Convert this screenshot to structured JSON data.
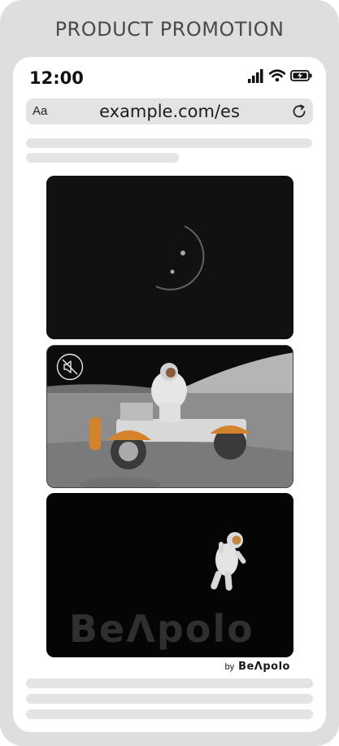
{
  "frame": {
    "title": "PRODUCT PROMOTION"
  },
  "status_bar": {
    "time": "12:00",
    "icons": [
      "cellular-signal-icon",
      "wifi-icon",
      "battery-charging-icon"
    ]
  },
  "browser": {
    "text_size_label": "Aa",
    "url": "example.com/es",
    "reload_icon": "reload-icon"
  },
  "ad": {
    "panels": [
      "moon-panel",
      "lunar-rover-panel",
      "astronaut-panel"
    ],
    "mute_icon": "muted-speaker-icon",
    "watermark": "BeΛpolo"
  },
  "credit": {
    "by": "by",
    "brand": "BeΛpolo"
  },
  "colors": {
    "frame": "#dedede",
    "phone": "#ffffff",
    "skeleton": "#e4e4e4",
    "ad_background": "#0d0d0d"
  }
}
